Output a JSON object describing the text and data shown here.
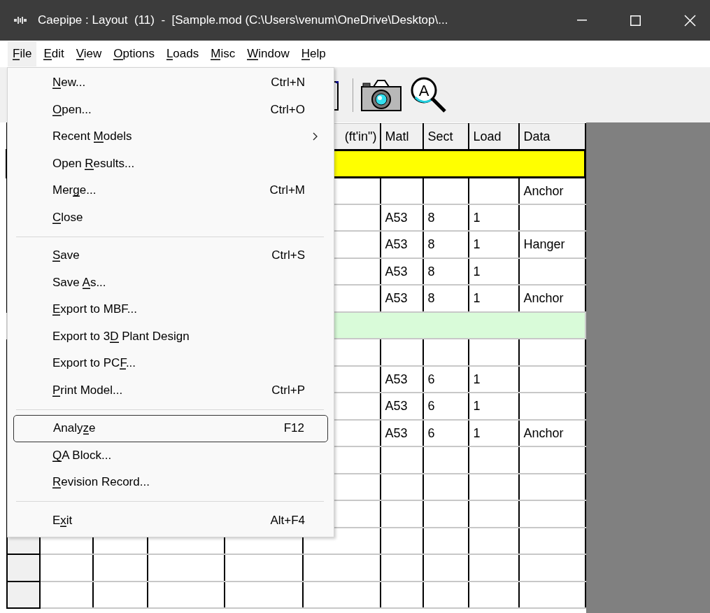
{
  "window": {
    "title": "Caepipe : Layout  (11)  -  [Sample.mod (C:\\Users\\venum\\OneDrive\\Desktop\\..."
  },
  "menu_bar": [
    {
      "label": [
        {
          "text": "F",
          "underline": true
        },
        {
          "text": "ile",
          "underline": false
        }
      ],
      "selected": true
    },
    {
      "label": [
        {
          "text": "E",
          "underline": true
        },
        {
          "text": "dit",
          "underline": false
        }
      ],
      "selected": false
    },
    {
      "label": [
        {
          "text": "V",
          "underline": true
        },
        {
          "text": "iew",
          "underline": false
        }
      ],
      "selected": false
    },
    {
      "label": [
        {
          "text": "O",
          "underline": true
        },
        {
          "text": "ptions",
          "underline": false
        }
      ],
      "selected": false
    },
    {
      "label": [
        {
          "text": "L",
          "underline": true
        },
        {
          "text": "oads",
          "underline": false
        }
      ],
      "selected": false
    },
    {
      "label": [
        {
          "text": "M",
          "underline": true
        },
        {
          "text": "isc",
          "underline": false
        }
      ],
      "selected": false
    },
    {
      "label": [
        {
          "text": "W",
          "underline": true
        },
        {
          "text": "indow",
          "underline": false
        }
      ],
      "selected": false
    },
    {
      "label": [
        {
          "text": "H",
          "underline": true
        },
        {
          "text": "elp",
          "underline": false
        }
      ],
      "selected": false
    }
  ],
  "toolbar": [
    {
      "kind": "cut"
    },
    {
      "kind": "separator"
    },
    {
      "kind": "camera"
    },
    {
      "kind": "magnifier",
      "glyph": "A"
    }
  ],
  "file_menu": [
    {
      "kind": "command",
      "label": [
        {
          "text": "N",
          "underline": true
        },
        {
          "text": "ew...",
          "underline": false
        }
      ],
      "shortcut": "Ctrl+N",
      "submenu": false,
      "selected": false
    },
    {
      "kind": "command",
      "label": [
        {
          "text": "O",
          "underline": true
        },
        {
          "text": "pen...",
          "underline": false
        }
      ],
      "shortcut": "Ctrl+O",
      "submenu": false,
      "selected": false
    },
    {
      "kind": "command",
      "label": [
        {
          "text": "Recent ",
          "underline": false
        },
        {
          "text": "M",
          "underline": true
        },
        {
          "text": "odels",
          "underline": false
        }
      ],
      "submenu": true,
      "selected": false
    },
    {
      "kind": "command",
      "label": [
        {
          "text": "Open ",
          "underline": false
        },
        {
          "text": "R",
          "underline": true
        },
        {
          "text": "esults...",
          "underline": false
        }
      ],
      "submenu": false,
      "selected": false
    },
    {
      "kind": "command",
      "label": [
        {
          "text": "Mer",
          "underline": false
        },
        {
          "text": "g",
          "underline": true
        },
        {
          "text": "e...",
          "underline": false
        }
      ],
      "shortcut": "Ctrl+M",
      "submenu": false,
      "selected": false
    },
    {
      "kind": "command",
      "label": [
        {
          "text": "C",
          "underline": true
        },
        {
          "text": "lose",
          "underline": false
        }
      ],
      "submenu": false,
      "selected": false
    },
    {
      "kind": "separator"
    },
    {
      "kind": "command",
      "label": [
        {
          "text": "S",
          "underline": true
        },
        {
          "text": "ave",
          "underline": false
        }
      ],
      "shortcut": "Ctrl+S",
      "submenu": false,
      "selected": false
    },
    {
      "kind": "command",
      "label": [
        {
          "text": "Save ",
          "underline": false
        },
        {
          "text": "A",
          "underline": true
        },
        {
          "text": "s...",
          "underline": false
        }
      ],
      "submenu": false,
      "selected": false
    },
    {
      "kind": "command",
      "label": [
        {
          "text": "E",
          "underline": true
        },
        {
          "text": "xport to MBF...",
          "underline": false
        }
      ],
      "submenu": false,
      "selected": false
    },
    {
      "kind": "command",
      "label": [
        {
          "text": "Export to 3",
          "underline": false
        },
        {
          "text": "D",
          "underline": true
        },
        {
          "text": " Plant Design",
          "underline": false
        }
      ],
      "submenu": false,
      "selected": false
    },
    {
      "kind": "command",
      "label": [
        {
          "text": "Export to PC",
          "underline": false
        },
        {
          "text": "F",
          "underline": true
        },
        {
          "text": "...",
          "underline": false
        }
      ],
      "submenu": false,
      "selected": false
    },
    {
      "kind": "command",
      "label": [
        {
          "text": "P",
          "underline": true
        },
        {
          "text": "rint Model...",
          "underline": false
        }
      ],
      "shortcut": "Ctrl+P",
      "submenu": false,
      "selected": false
    },
    {
      "kind": "separator"
    },
    {
      "kind": "command",
      "label": [
        {
          "text": "Analy",
          "underline": false
        },
        {
          "text": "z",
          "underline": true
        },
        {
          "text": "e",
          "underline": false
        }
      ],
      "shortcut": "F12",
      "submenu": false,
      "selected": true
    },
    {
      "kind": "command",
      "label": [
        {
          "text": "Q",
          "underline": true
        },
        {
          "text": "A Block...",
          "underline": false
        }
      ],
      "submenu": false,
      "selected": false
    },
    {
      "kind": "command",
      "label": [
        {
          "text": "R",
          "underline": true
        },
        {
          "text": "evision Record...",
          "underline": false
        }
      ],
      "submenu": false,
      "selected": false
    },
    {
      "kind": "separator"
    },
    {
      "kind": "command",
      "label": [
        {
          "text": "E",
          "underline": false
        },
        {
          "text": "x",
          "underline": true
        },
        {
          "text": "it",
          "underline": false
        }
      ],
      "shortcut": "Alt+F4",
      "submenu": false,
      "selected": false
    }
  ],
  "table": {
    "columns": [
      "(ft'in\")",
      "Matl",
      "Sect",
      "Load",
      "Data"
    ],
    "rows": [
      {
        "kind": "band",
        "color": "#ffff00",
        "selected": true
      },
      {
        "kind": "data",
        "cells": [
          null,
          null,
          null,
          null,
          "Anchor"
        ]
      },
      {
        "kind": "data",
        "cells": [
          null,
          "A53",
          "8",
          "1",
          null
        ]
      },
      {
        "kind": "data",
        "cells": [
          null,
          "A53",
          "8",
          "1",
          "Hanger"
        ]
      },
      {
        "kind": "data",
        "cells": [
          null,
          "A53",
          "8",
          "1",
          null
        ]
      },
      {
        "kind": "data",
        "cells": [
          null,
          "A53",
          "8",
          "1",
          "Anchor"
        ]
      },
      {
        "kind": "band",
        "color": "#d9fbd9",
        "selected": false
      },
      {
        "kind": "data"
      },
      {
        "kind": "data",
        "cells": [
          null,
          "A53",
          "6",
          "1",
          null
        ]
      },
      {
        "kind": "data",
        "cells": [
          null,
          "A53",
          "6",
          "1",
          null
        ]
      },
      {
        "kind": "data",
        "cells": [
          null,
          "A53",
          "6",
          "1",
          "Anchor"
        ]
      },
      {
        "kind": "data"
      },
      {
        "kind": "data"
      },
      {
        "kind": "data"
      },
      {
        "kind": "data"
      },
      {
        "kind": "data"
      },
      {
        "kind": "data"
      }
    ]
  }
}
